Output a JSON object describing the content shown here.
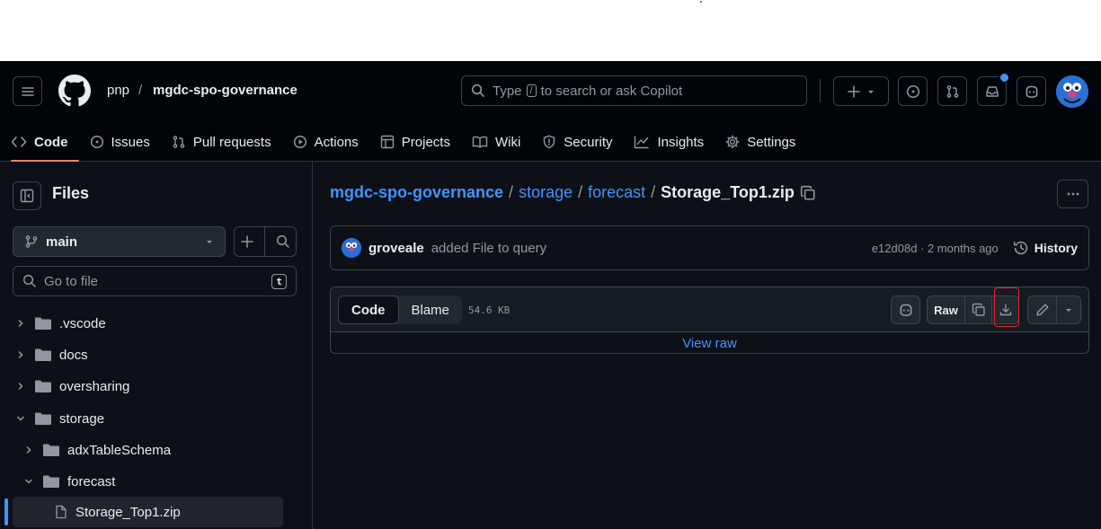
{
  "header": {
    "owner": "pnp",
    "separator": "/",
    "repo": "mgdc-spo-governance",
    "search": {
      "prefix": "Type",
      "key": "/",
      "suffix": "to search or ask Copilot"
    }
  },
  "tabs": [
    {
      "label": "Code"
    },
    {
      "label": "Issues"
    },
    {
      "label": "Pull requests"
    },
    {
      "label": "Actions"
    },
    {
      "label": "Projects"
    },
    {
      "label": "Wiki"
    },
    {
      "label": "Security"
    },
    {
      "label": "Insights"
    },
    {
      "label": "Settings"
    }
  ],
  "sidebar": {
    "title": "Files",
    "branch": "main",
    "go_to_file": "Go to file",
    "go_to_file_key": "t",
    "tree": [
      {
        "label": ".vscode"
      },
      {
        "label": "docs"
      },
      {
        "label": "oversharing"
      },
      {
        "label": "storage"
      },
      {
        "label": "adxTableSchema"
      },
      {
        "label": "forecast"
      },
      {
        "label": "Storage_Top1.zip"
      }
    ]
  },
  "breadcrumb": {
    "repo": "mgdc-spo-governance",
    "sep": "/",
    "dir1": "storage",
    "dir2": "forecast",
    "file": "Storage_Top1.zip"
  },
  "commit": {
    "author": "groveale",
    "message": "added File to query",
    "sha_time": "e12d08d · 2 months ago",
    "history": "History"
  },
  "file": {
    "tab_code": "Code",
    "tab_blame": "Blame",
    "size": "54.6 KB",
    "raw": "Raw",
    "view_raw": "View raw"
  },
  "colors": {
    "bg": "#0d1117",
    "header_bg": "#010409",
    "link": "#4493f8",
    "active_tab_underline": "#f78166",
    "annotation": "#e5242b"
  }
}
